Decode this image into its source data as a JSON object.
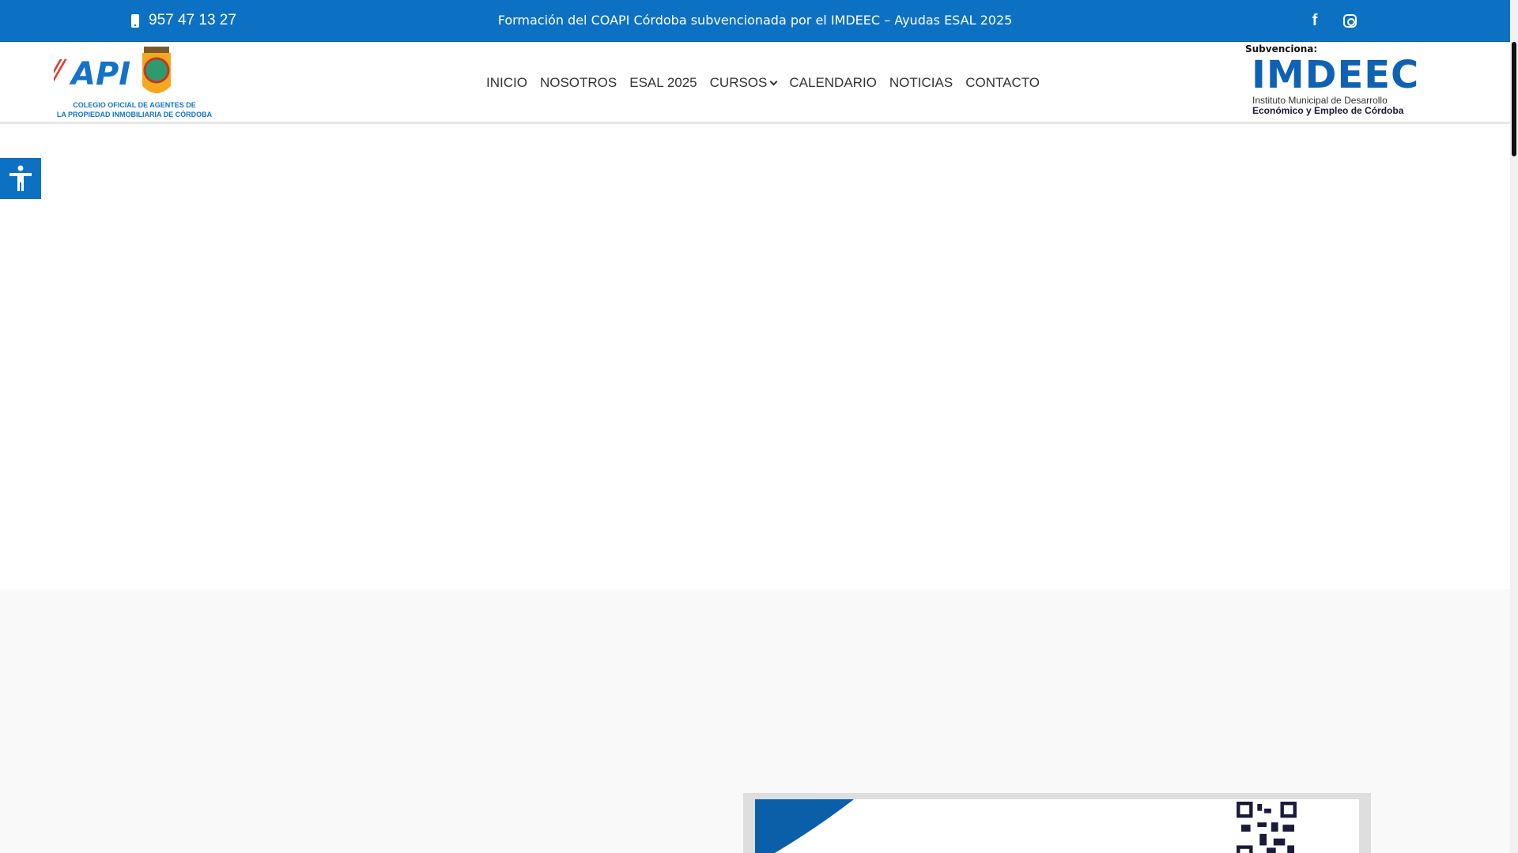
{
  "topbar": {
    "phone": "957 47 13 27",
    "promo": "Formación del COAPI Córdoba subvencionada por el IMDEEC – Ayudas ESAL 2025",
    "social": [
      "facebook-icon",
      "instagram-icon"
    ]
  },
  "header": {
    "logo": {
      "mark": "API",
      "line1": "COLEGIO OFICIAL DE AGENTES DE",
      "line2": "LA PROPIEDAD INMOBILIARIA DE CÓRDOBA"
    },
    "nav": [
      "INICIO",
      "NOSOTROS",
      "ESAL 2025",
      "CURSOS",
      "CALENDARIO",
      "NOTICIAS",
      "CONTACTO"
    ],
    "sponsor": {
      "label": "Subvenciona:",
      "name": "IMDEEC",
      "line1": "Instituto Municipal de Desarrollo",
      "line2": "Económico y Empleo de Córdoba"
    }
  },
  "colors": {
    "brand": "#0d71c3",
    "section_bg": "#f9f9f9"
  }
}
